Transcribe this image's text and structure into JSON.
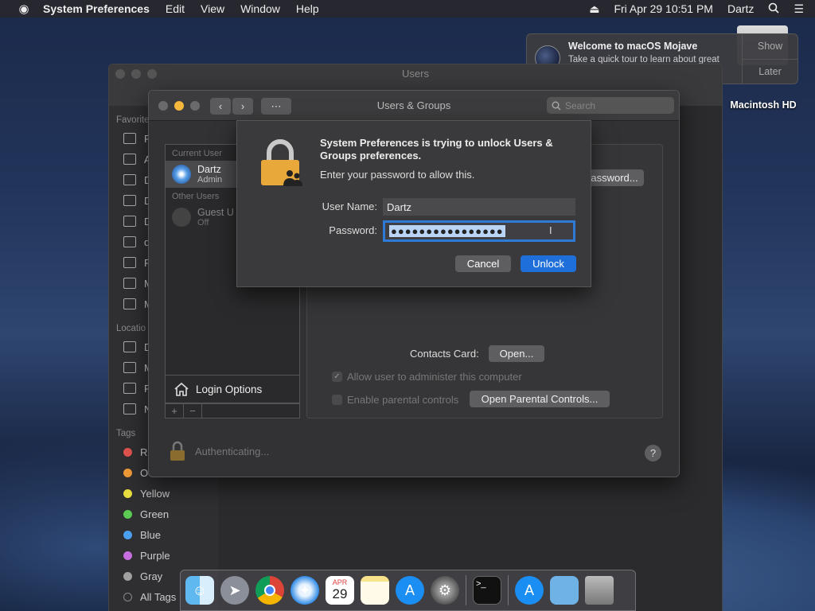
{
  "menubar": {
    "apple": "",
    "app": "System Preferences",
    "items": [
      "Edit",
      "View",
      "Window",
      "Help"
    ],
    "datetime": "Fri Apr 29  10:51 PM",
    "user": "Dartz",
    "icons": [
      "eject-icon",
      "search-icon",
      "list-icon"
    ]
  },
  "notification": {
    "title": "Welcome to macOS Mojave",
    "text": "Take a quick tour to learn about great new features.",
    "show": "Show",
    "later": "Later"
  },
  "desktop": {
    "disk_label": "Macintosh HD"
  },
  "finder": {
    "title": "Users",
    "favorites_header": "Favorite",
    "favorites": [
      "R",
      "A",
      "D",
      "D",
      "D",
      "d",
      "P",
      "M",
      "M"
    ],
    "locations_header": "Locatio",
    "locations": [
      "D",
      "M",
      "R",
      "N"
    ],
    "tags_header": "Tags",
    "tags": [
      {
        "label": "R",
        "color": "#e0534f"
      },
      {
        "label": "O",
        "color": "#f09a37"
      },
      {
        "label": "Yellow",
        "color": "#e8dd40"
      },
      {
        "label": "Green",
        "color": "#5ccb54"
      },
      {
        "label": "Blue",
        "color": "#4a9ff0"
      },
      {
        "label": "Purple",
        "color": "#c66ee0"
      },
      {
        "label": "Gray",
        "color": "#a0a0a0"
      }
    ],
    "all_tags": "All Tags"
  },
  "users_groups": {
    "title": "Users & Groups",
    "search_placeholder": "Search",
    "current_user_header": "Current User",
    "current_user": {
      "name": "Dartz",
      "role": "Admin"
    },
    "other_users_header": "Other Users",
    "guest_user": {
      "name": "Guest U",
      "role": "Off"
    },
    "login_options": "Login Options",
    "change_password": "assword...",
    "contacts_card_label": "Contacts Card:",
    "open_button": "Open...",
    "allow_admin": "Allow user to administer this computer",
    "parental_controls": "Enable parental controls",
    "open_parental": "Open Parental Controls...",
    "authenticating": "Authenticating...",
    "help": "?"
  },
  "auth_sheet": {
    "message": "System Preferences is trying to unlock Users & Groups preferences.",
    "sub": "Enter your password to allow this.",
    "username_label": "User Name:",
    "username_value": "Dartz",
    "password_label": "Password:",
    "password_value": "●●●●●●●●●●●●●●●●",
    "cancel": "Cancel",
    "unlock": "Unlock"
  },
  "dock": {
    "apps": [
      "finder-icon",
      "launchpad-icon",
      "chrome-icon",
      "safari-icon",
      "calendar-icon",
      "notes-icon",
      "app-store-icon",
      "system-preferences-icon",
      "terminal-icon",
      "app-store-folder-icon",
      "folder-icon",
      "trash-icon"
    ],
    "calendar_month": "APR",
    "calendar_day": "29",
    "terminal_prompt": ">_"
  }
}
